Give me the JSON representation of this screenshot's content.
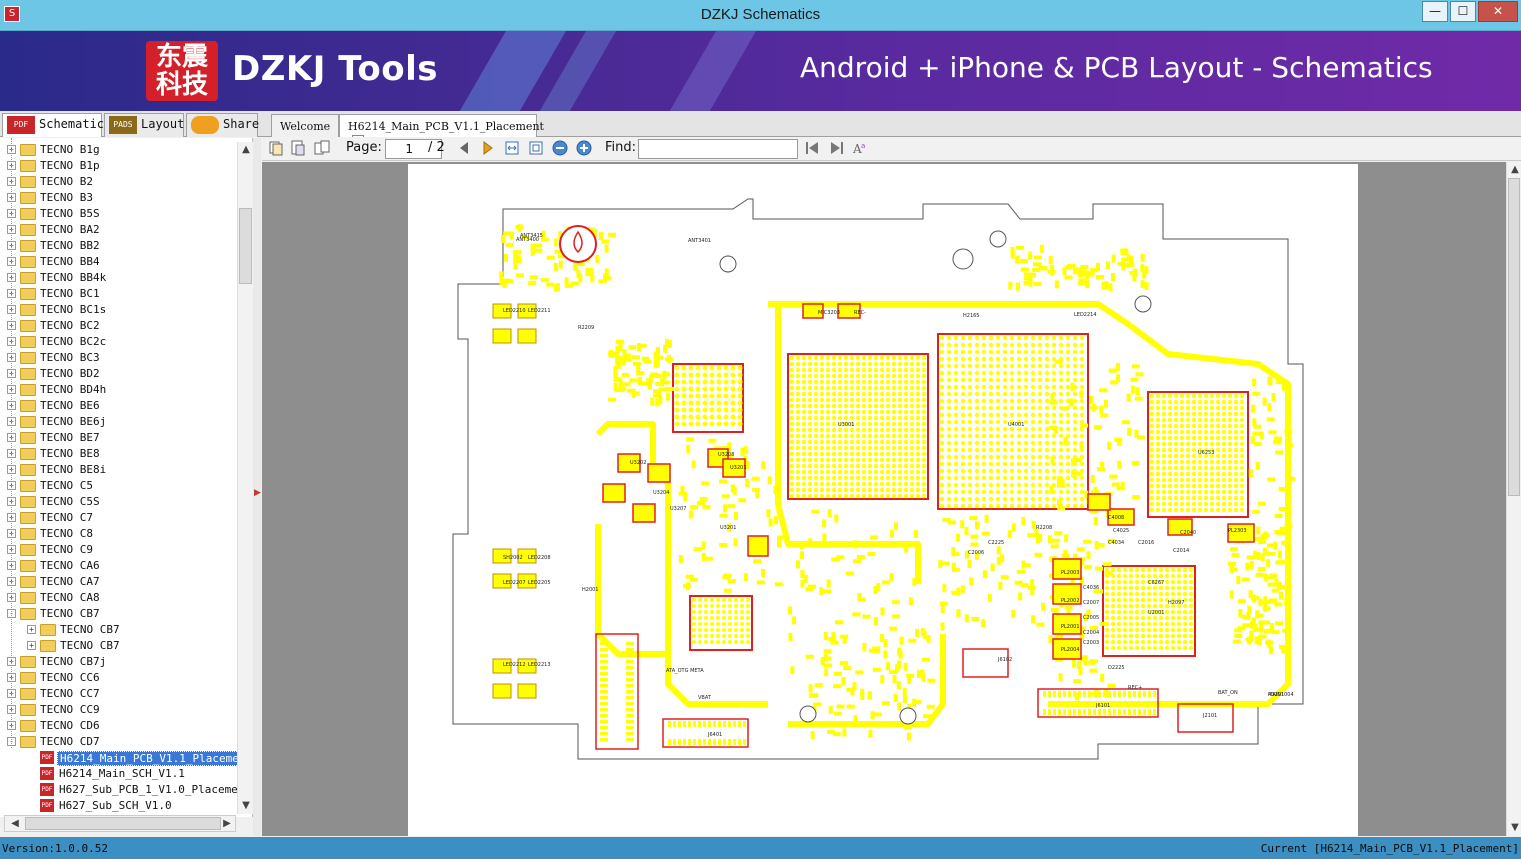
{
  "window": {
    "title": "DZKJ Schematics",
    "minimize": "—",
    "maximize": "☐",
    "close": "✕"
  },
  "banner": {
    "logo_text": "东震科技",
    "brand": "DZKJ Tools",
    "tagline": "Android + iPhone & PCB Layout - Schematics"
  },
  "left_tabs": [
    {
      "label": "Schematic",
      "icon": "PDF"
    },
    {
      "label": "Layout",
      "icon": "PADS"
    },
    {
      "label": "Share",
      "icon": "cloud"
    }
  ],
  "doc_tabs": [
    {
      "label": "Welcome"
    },
    {
      "label": "H6214_Main_PCB_V1.1_Placement"
    }
  ],
  "tree": [
    {
      "label": "TECNO B1g",
      "type": "folder",
      "level": 0,
      "exp": "+"
    },
    {
      "label": "TECNO B1p",
      "type": "folder",
      "level": 0,
      "exp": "+"
    },
    {
      "label": "TECNO B2",
      "type": "folder",
      "level": 0,
      "exp": "+"
    },
    {
      "label": "TECNO B3",
      "type": "folder",
      "level": 0,
      "exp": "+"
    },
    {
      "label": "TECNO B5S",
      "type": "folder",
      "level": 0,
      "exp": "+"
    },
    {
      "label": "TECNO BA2",
      "type": "folder",
      "level": 0,
      "exp": "+"
    },
    {
      "label": "TECNO BB2",
      "type": "folder",
      "level": 0,
      "exp": "+"
    },
    {
      "label": "TECNO BB4",
      "type": "folder",
      "level": 0,
      "exp": "+"
    },
    {
      "label": "TECNO BB4k",
      "type": "folder",
      "level": 0,
      "exp": "+"
    },
    {
      "label": "TECNO BC1",
      "type": "folder",
      "level": 0,
      "exp": "+"
    },
    {
      "label": "TECNO BC1s",
      "type": "folder",
      "level": 0,
      "exp": "+"
    },
    {
      "label": "TECNO BC2",
      "type": "folder",
      "level": 0,
      "exp": "+"
    },
    {
      "label": "TECNO BC2c",
      "type": "folder",
      "level": 0,
      "exp": "+"
    },
    {
      "label": "TECNO BC3",
      "type": "folder",
      "level": 0,
      "exp": "+"
    },
    {
      "label": "TECNO BD2",
      "type": "folder",
      "level": 0,
      "exp": "+"
    },
    {
      "label": "TECNO BD4h",
      "type": "folder",
      "level": 0,
      "exp": "+"
    },
    {
      "label": "TECNO BE6",
      "type": "folder",
      "level": 0,
      "exp": "+"
    },
    {
      "label": "TECNO BE6j",
      "type": "folder",
      "level": 0,
      "exp": "+"
    },
    {
      "label": "TECNO BE7",
      "type": "folder",
      "level": 0,
      "exp": "+"
    },
    {
      "label": "TECNO BE8",
      "type": "folder",
      "level": 0,
      "exp": "+"
    },
    {
      "label": "TECNO BE8i",
      "type": "folder",
      "level": 0,
      "exp": "+"
    },
    {
      "label": "TECNO C5",
      "type": "folder",
      "level": 0,
      "exp": "+"
    },
    {
      "label": "TECNO C5S",
      "type": "folder",
      "level": 0,
      "exp": "+"
    },
    {
      "label": "TECNO C7",
      "type": "folder",
      "level": 0,
      "exp": "+"
    },
    {
      "label": "TECNO C8",
      "type": "folder",
      "level": 0,
      "exp": "+"
    },
    {
      "label": "TECNO C9",
      "type": "folder",
      "level": 0,
      "exp": "+"
    },
    {
      "label": "TECNO CA6",
      "type": "folder",
      "level": 0,
      "exp": "+"
    },
    {
      "label": "TECNO CA7",
      "type": "folder",
      "level": 0,
      "exp": "+"
    },
    {
      "label": "TECNO CA8",
      "type": "folder",
      "level": 0,
      "exp": "+"
    },
    {
      "label": "TECNO CB7",
      "type": "folder",
      "level": 0,
      "exp": "-"
    },
    {
      "label": "TECNO CB7",
      "type": "folder",
      "level": 1,
      "exp": "+"
    },
    {
      "label": "TECNO CB7",
      "type": "folder",
      "level": 1,
      "exp": "+"
    },
    {
      "label": "TECNO CB7j",
      "type": "folder",
      "level": 0,
      "exp": "+"
    },
    {
      "label": "TECNO CC6",
      "type": "folder",
      "level": 0,
      "exp": "+"
    },
    {
      "label": "TECNO CC7",
      "type": "folder",
      "level": 0,
      "exp": "+"
    },
    {
      "label": "TECNO CC9",
      "type": "folder",
      "level": 0,
      "exp": "+"
    },
    {
      "label": "TECNO CD6",
      "type": "folder",
      "level": 0,
      "exp": "+"
    },
    {
      "label": "TECNO CD7",
      "type": "folder",
      "level": 0,
      "exp": "-"
    },
    {
      "label": "H6214_Main_PCB_V1.1_Placement",
      "type": "pdf",
      "level": 1,
      "selected": true
    },
    {
      "label": "H6214_Main_SCH_V1.1",
      "type": "pdf",
      "level": 1
    },
    {
      "label": "H627_Sub_PCB_1_V1.0_Placement",
      "type": "pdf",
      "level": 1
    },
    {
      "label": "H627_Sub_SCH_V1.0",
      "type": "pdf",
      "level": 1
    }
  ],
  "toolbar": {
    "page_label": "Page:",
    "page_value": "1",
    "page_total": "/ 2",
    "find_label": "Find:",
    "find_value": ""
  },
  "pcb": {
    "labels": [
      "U3001",
      "U4001",
      "U6253",
      "U3201",
      "U3202",
      "U3203",
      "U3204",
      "U3207",
      "U3208",
      "U2001",
      "J6401",
      "J6101",
      "J6102",
      "J2101",
      "PL2001",
      "PL2002",
      "PL2003",
      "PL2004",
      "PL2303",
      "ANT3415",
      "ANT3401",
      "ANT3400",
      "MIC3203",
      "REC-",
      "REC+",
      "BAT_ON",
      "VBAT",
      "ATA_OTG META",
      "SH2002",
      "LED2207",
      "LED2208",
      "LED2205",
      "LED2210",
      "LED2211",
      "LED2212",
      "LED2213",
      "LED2214",
      "C4008",
      "C4025",
      "C4036",
      "C2007",
      "C2005",
      "C2004",
      "C2003",
      "C2006",
      "C2225",
      "D2225",
      "H2001",
      "R2209",
      "R2208",
      "C4034",
      "C2016",
      "C2040",
      "C2014",
      "C6267",
      "H2097",
      "H2165",
      "R3201",
      "MAIN1004"
    ],
    "colors": {
      "pad": "#ffff00",
      "outline": "#e02020",
      "board": "#555555"
    }
  },
  "status": {
    "version": "Version:1.0.0.52",
    "current": "Current [H6214_Main_PCB_V1.1_Placement]"
  }
}
